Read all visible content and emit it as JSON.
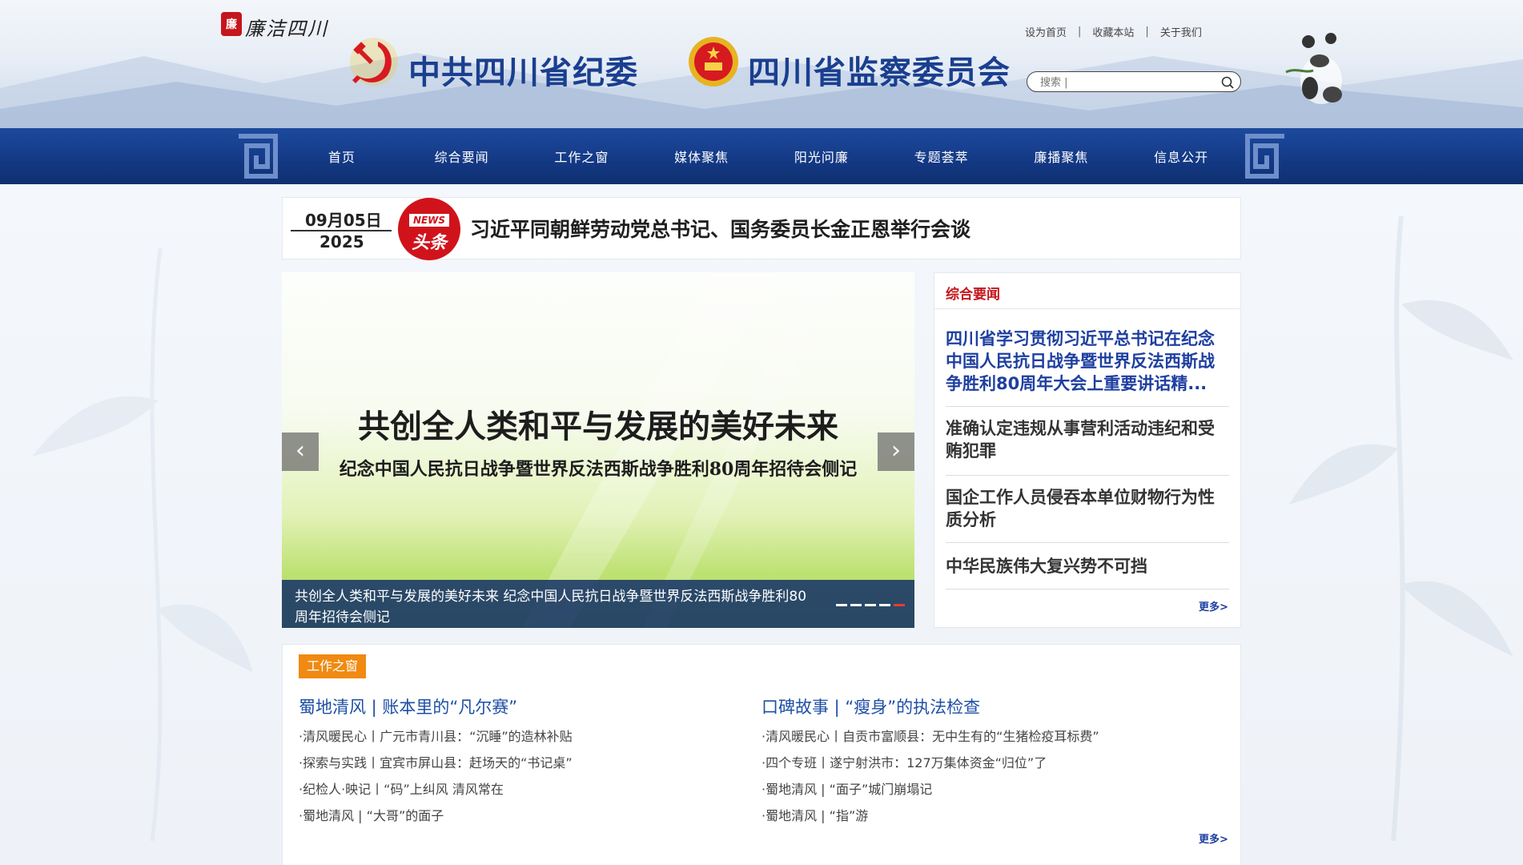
{
  "header": {
    "brand_seal": "廉",
    "brand_text": "廉洁四川",
    "title_left": "中共四川省纪委",
    "title_right": "四川省监察委员会",
    "top_links": [
      "设为首页",
      "收藏本站",
      "关于我们"
    ],
    "separator": "|",
    "search": {
      "placeholder": "搜索 |"
    }
  },
  "nav": {
    "items": [
      "首页",
      "综合要闻",
      "工作之窗",
      "媒体聚焦",
      "阳光问廉",
      "专题荟萃",
      "廉播聚焦",
      "信息公开"
    ]
  },
  "headline": {
    "date_md": "09月05日",
    "year": "2025",
    "badge_en": "NEWS",
    "badge_cn": "头条",
    "title": "习近平同朝鲜劳动党总书记、国务委员长金正恩举行会谈"
  },
  "carousel": {
    "slide_title": "共创全人类和平与发展的美好未来",
    "slide_subtitle": "纪念中国人民抗日战争暨世界反法西斯战争胜利80周年招待会侧记",
    "caption": "共创全人类和平与发展的美好未来 纪念中国人民抗日战争暨世界反法西斯战争胜利80周年招待会侧记",
    "prev_icon": "‹",
    "next_icon": "›",
    "slide_count": 5,
    "active_slide": 5
  },
  "news_panel": {
    "title": "综合要闻",
    "lead": "四川省学习贯彻习近平总书记在纪念中国人民抗日战争暨世界反法西斯战争胜利80周年大会上重要讲话精...",
    "items": [
      "准确认定违规从事营利活动违纪和受贿犯罪",
      "国企工作人员侵吞本单位财物行为性质分析",
      "中华民族伟大复兴势不可挡"
    ],
    "more": "更多>"
  },
  "work_window": {
    "tag": "工作之窗",
    "left": {
      "title": "蜀地清风 | 账本里的“凡尔赛”",
      "items": [
        "·清风暖民心丨广元市青川县：“沉睡”的造林补贴",
        "·探索与实践丨宜宾市屏山县：赶场天的“书记桌”",
        "·纪检人·映记丨“码”上纠风 清风常在",
        "·蜀地清风 | “大哥”的面子"
      ]
    },
    "right": {
      "title": "口碑故事 | “瘦身”的执法检查",
      "items": [
        "·清风暖民心丨自贡市富顺县：无中生有的“生猪检疫耳标费”",
        "·四个专班丨遂宁射洪市：127万集体资金“归位”了",
        "·蜀地清风 | “面子”城门崩塌记",
        "·蜀地清风 | “指”游"
      ]
    },
    "more": "更多>"
  },
  "colors": {
    "nav_blue": "#143a86",
    "accent_red": "#c4161c",
    "link_blue": "#1e3fa0",
    "tag_orange": "#f08a12"
  }
}
